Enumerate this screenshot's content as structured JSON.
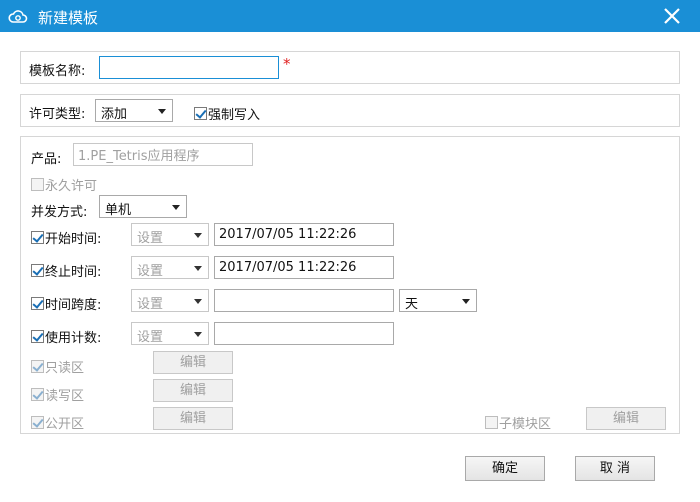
{
  "window": {
    "title": "新建模板",
    "accent_color": "#1a8fd6",
    "app_icon": "cloud-icon",
    "close_icon": "close-icon"
  },
  "name_row": {
    "label": "模板名称:",
    "value": "",
    "required_mark": "*"
  },
  "license_row": {
    "type_label": "许可类型:",
    "type_value": "添加",
    "force_write_label": "强制写入",
    "force_write_checked": true
  },
  "product": {
    "label": "产品:",
    "value": "1.PE_Tetris应用程序"
  },
  "permanent": {
    "label": "永久许可",
    "checked": false
  },
  "concurrency": {
    "label": "并发方式:",
    "value": "单机"
  },
  "start_time": {
    "label": "开始时间:",
    "checked": true,
    "mode": "设置",
    "value": "2017/07/05 11:22:26"
  },
  "end_time": {
    "label": "终止时间:",
    "checked": true,
    "mode": "设置",
    "value": "2017/07/05 11:22:26"
  },
  "time_span": {
    "label": "时间跨度:",
    "checked": true,
    "mode": "设置",
    "value": "",
    "unit": "天"
  },
  "usage_count": {
    "label": "使用计数:",
    "checked": true,
    "mode": "设置",
    "value": ""
  },
  "areas": {
    "readonly": {
      "label": "只读区",
      "checked": true,
      "edit_label": "编辑"
    },
    "readwrite": {
      "label": "读写区",
      "checked": true,
      "edit_label": "编辑"
    },
    "public": {
      "label": "公开区",
      "checked": true,
      "edit_label": "编辑"
    },
    "submodule": {
      "label": "子模块区",
      "checked": false,
      "edit_label": "编辑"
    }
  },
  "footer": {
    "ok_label": "确定",
    "cancel_label": "取 消"
  }
}
